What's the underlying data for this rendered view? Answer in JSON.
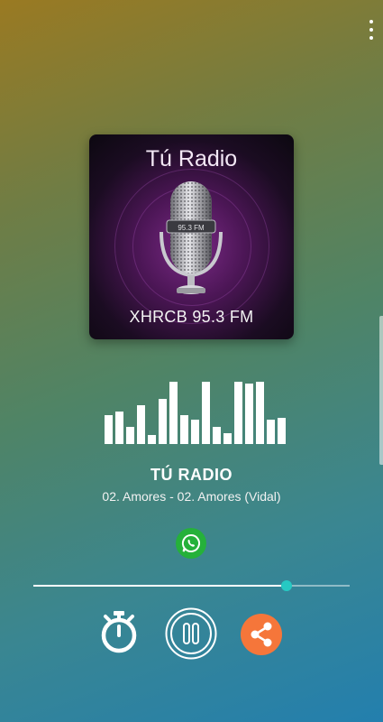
{
  "top_bar": {
    "menu_icon": "more-vertical-icon"
  },
  "cover": {
    "title": "Tú Radio",
    "mic_badge": "95.3 FM",
    "frequency": "XHRCB 95.3 FM"
  },
  "equalizer": {
    "levels": [
      0.45,
      0.5,
      0.26,
      0.6,
      0.14,
      0.7,
      0.96,
      0.44,
      0.38,
      0.96,
      0.26,
      0.16,
      0.96,
      0.93,
      0.96,
      0.37,
      0.4
    ]
  },
  "now_playing": {
    "station": "TÚ RADIO",
    "song": "02. Amores - 02. Amores (Vidal)"
  },
  "share_whatsapp": {
    "icon": "whatsapp-icon",
    "color": "#25b13a"
  },
  "progress": {
    "value": 0.8,
    "thumb_color": "#26c9c3"
  },
  "controls": {
    "timer_icon": "stopwatch-icon",
    "play_pause_icon": "pause-icon",
    "share_icon": "share-icon",
    "share_color": "#f5763a"
  }
}
